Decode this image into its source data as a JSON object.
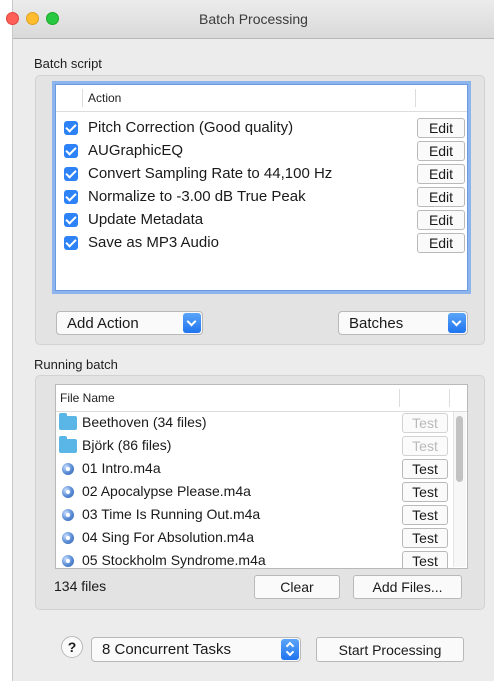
{
  "window": {
    "title": "Batch Processing"
  },
  "batch_script": {
    "label": "Batch script",
    "column_header": "Action",
    "edit_label": "Edit",
    "actions": [
      {
        "label": "Pitch Correction (Good quality)",
        "checked": true
      },
      {
        "label": "AUGraphicEQ",
        "checked": true
      },
      {
        "label": "Convert Sampling Rate to 44,100 Hz",
        "checked": true
      },
      {
        "label": "Normalize to -3.00 dB True Peak",
        "checked": true
      },
      {
        "label": "Update Metadata",
        "checked": true
      },
      {
        "label": "Save as MP3 Audio",
        "checked": true
      }
    ],
    "add_action": "Add Action",
    "batches": "Batches"
  },
  "running_batch": {
    "label": "Running batch",
    "column_header": "File Name",
    "test_label": "Test",
    "files": [
      {
        "name": "Beethoven (34 files)",
        "icon": "folder-icon",
        "test_enabled": false
      },
      {
        "name": "Björk (86 files)",
        "icon": "folder-icon",
        "test_enabled": false
      },
      {
        "name": "01 Intro.m4a",
        "icon": "audio-file-icon",
        "test_enabled": true
      },
      {
        "name": "02 Apocalypse Please.m4a",
        "icon": "audio-file-icon",
        "test_enabled": true
      },
      {
        "name": "03 Time Is Running Out.m4a",
        "icon": "audio-file-icon",
        "test_enabled": true
      },
      {
        "name": "04 Sing For Absolution.m4a",
        "icon": "audio-file-icon",
        "test_enabled": true
      },
      {
        "name": "05 Stockholm Syndrome.m4a",
        "icon": "audio-file-icon",
        "test_enabled": true
      }
    ],
    "file_count": "134 files",
    "clear": "Clear",
    "add_files": "Add Files..."
  },
  "footer": {
    "help": "?",
    "concurrent": "8 Concurrent Tasks",
    "start": "Start Processing"
  },
  "colors": {
    "accent": "#2d82f7",
    "focus_ring": "#8db4ec",
    "folder": "#5bb6e8"
  }
}
